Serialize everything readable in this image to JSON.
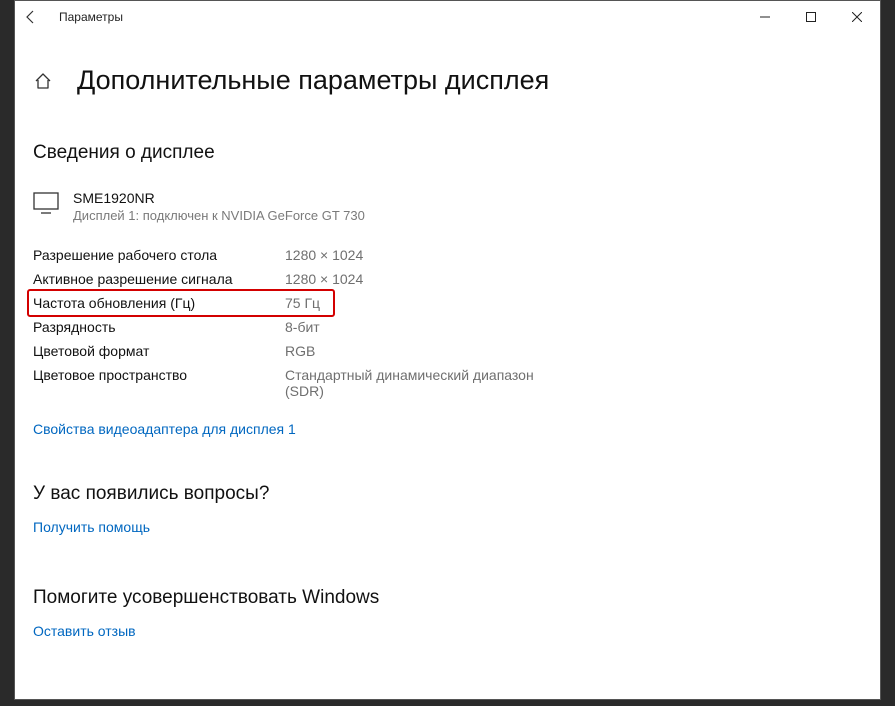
{
  "titlebar": {
    "app_name": "Параметры"
  },
  "page": {
    "title": "Дополнительные параметры дисплея"
  },
  "display_info": {
    "heading": "Сведения о дисплее",
    "monitor_name": "SME1920NR",
    "monitor_connection": "Дисплей 1: подключен к NVIDIA GeForce GT 730",
    "rows": [
      {
        "label": "Разрешение рабочего стола",
        "value": "1280 × 1024"
      },
      {
        "label": "Активное разрешение сигнала",
        "value": "1280 × 1024"
      },
      {
        "label": "Частота обновления (Гц)",
        "value": "75 Гц"
      },
      {
        "label": "Разрядность",
        "value": "8-бит"
      },
      {
        "label": "Цветовой формат",
        "value": "RGB"
      },
      {
        "label": "Цветовое пространство",
        "value": "Стандартный динамический диапазон (SDR)"
      }
    ],
    "adapter_link": "Свойства видеоадаптера для дисплея 1"
  },
  "help": {
    "heading": "У вас появились вопросы?",
    "link": "Получить помощь"
  },
  "feedback": {
    "heading": "Помогите усовершенствовать Windows",
    "link": "Оставить отзыв"
  }
}
